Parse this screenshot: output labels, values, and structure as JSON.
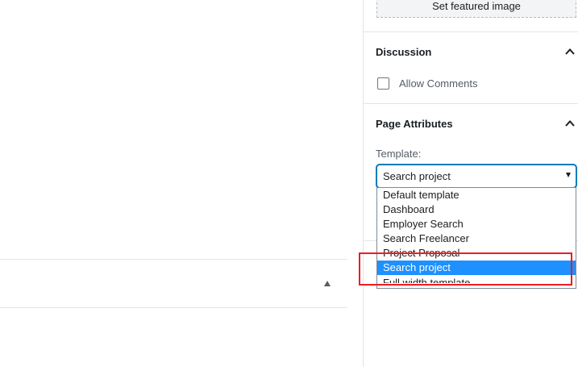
{
  "featured_image": {
    "button_label": "Set featured image"
  },
  "discussion": {
    "title": "Discussion",
    "allow_comments_label": "Allow Comments",
    "allow_comments_checked": false
  },
  "page_attributes": {
    "title": "Page Attributes",
    "template_label": "Template:",
    "selected_template": "Search project",
    "options": [
      "Default template",
      "Dashboard",
      "Employer Search",
      "Search Freelancer",
      "Project Proposal",
      "Search project",
      "Full width template"
    ],
    "highlighted_index": 5
  },
  "colors": {
    "accent": "#007cba",
    "selected_option_bg": "#1e90ff",
    "annotation_red": "#ee1c24"
  }
}
